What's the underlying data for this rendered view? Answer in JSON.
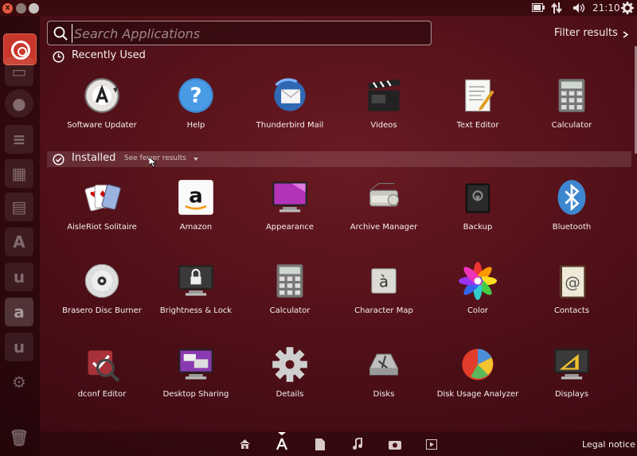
{
  "topbar": {
    "close": "x",
    "clock": "21:10"
  },
  "search": {
    "placeholder": "Search Applications",
    "filter_label": "Filter results"
  },
  "recently_used": {
    "title": "Recently Used",
    "apps": [
      {
        "label": "Software Updater",
        "icon": "software-updater-icon"
      },
      {
        "label": "Help",
        "icon": "help-icon"
      },
      {
        "label": "Thunderbird Mail",
        "icon": "thunderbird-icon"
      },
      {
        "label": "Videos",
        "icon": "videos-icon"
      },
      {
        "label": "Text Editor",
        "icon": "text-editor-icon"
      },
      {
        "label": "Calculator",
        "icon": "calculator-icon"
      }
    ]
  },
  "installed": {
    "title": "Installed",
    "see_fewer": "See fewer results",
    "apps": [
      {
        "label": "AisleRiot Solitaire",
        "icon": "cards-icon"
      },
      {
        "label": "Amazon",
        "icon": "amazon-icon"
      },
      {
        "label": "Appearance",
        "icon": "appearance-icon"
      },
      {
        "label": "Archive Manager",
        "icon": "archive-manager-icon"
      },
      {
        "label": "Backup",
        "icon": "backup-icon"
      },
      {
        "label": "Bluetooth",
        "icon": "bluetooth-icon"
      },
      {
        "label": "Brasero Disc Burner",
        "icon": "disc-icon"
      },
      {
        "label": "Brightness & Lock",
        "icon": "brightness-lock-icon"
      },
      {
        "label": "Calculator",
        "icon": "calculator-icon"
      },
      {
        "label": "Character Map",
        "icon": "character-map-icon"
      },
      {
        "label": "Color",
        "icon": "color-icon"
      },
      {
        "label": "Contacts",
        "icon": "contacts-icon"
      },
      {
        "label": "dconf Editor",
        "icon": "dconf-editor-icon"
      },
      {
        "label": "Desktop Sharing",
        "icon": "desktop-sharing-icon"
      },
      {
        "label": "Details",
        "icon": "gear-icon"
      },
      {
        "label": "Disks",
        "icon": "disks-icon"
      },
      {
        "label": "Disk Usage Analyzer",
        "icon": "disk-usage-icon"
      },
      {
        "label": "Displays",
        "icon": "displays-icon"
      }
    ]
  },
  "launcher_letters": {
    "amazon": "a",
    "ubuntu_one": "u",
    "ubuntu_one_2": "u"
  },
  "lenses": [
    "home-lens-icon",
    "applications-lens-icon",
    "files-lens-icon",
    "music-lens-icon",
    "photos-lens-icon",
    "video-lens-icon"
  ],
  "legal_notice": "Legal notice",
  "colors": {
    "background": "#4e0f17",
    "accent": "#c8382a"
  }
}
